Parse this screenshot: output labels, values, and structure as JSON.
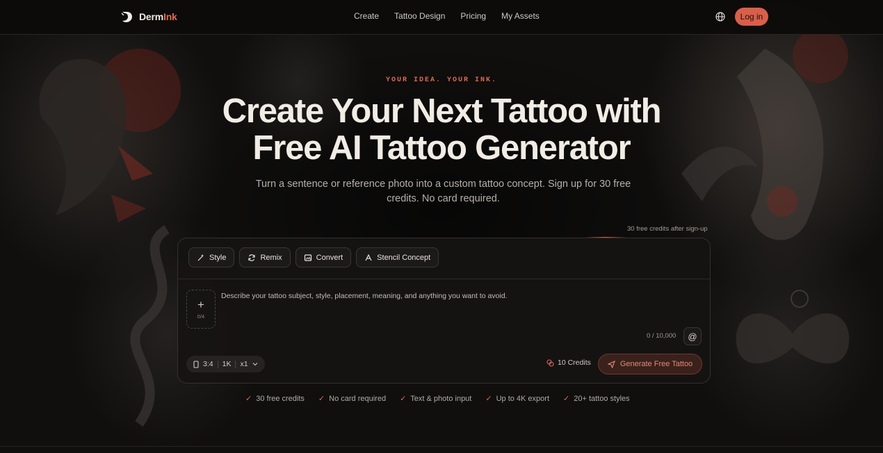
{
  "brand": {
    "name_prefix": "Derm",
    "name_suffix": "Ink",
    "accent": "#d95f4a"
  },
  "nav": {
    "links": [
      "Create",
      "Tattoo Design",
      "Pricing",
      "My Assets"
    ],
    "language_icon": "globe-icon",
    "login_label": "Log in"
  },
  "hero": {
    "eyebrow": "YOUR IDEA. YOUR INK.",
    "title_line1": "Create Your Next Tattoo with",
    "title_line2": "Free AI Tattoo Generator",
    "subtitle": "Turn a sentence or reference photo into a custom tattoo concept. Sign up for 30 free credits. No card required.",
    "free_note": "30 free credits after sign-up"
  },
  "composer": {
    "modes": [
      {
        "label": "Style",
        "icon": "magic-wand-icon"
      },
      {
        "label": "Remix",
        "icon": "refresh-icon"
      },
      {
        "label": "Convert",
        "icon": "image-convert-icon"
      },
      {
        "label": "Stencil Concept",
        "icon": "stencil-icon"
      }
    ],
    "upload_plus": "+",
    "upload_count": "0/4",
    "prompt_placeholder": "Describe your tattoo subject, style, placement, meaning, and anything you want to avoid.",
    "char_count": "0 / 10,000",
    "mention_symbol": "@",
    "aspect_ratio": "3:4",
    "resolution": "1K",
    "quantity": "x1",
    "credits": "10 Credits",
    "generate_label": "Generate Free Tattoo"
  },
  "features": [
    "30 free credits",
    "No card required",
    "Text & photo input",
    "Up to 4K export",
    "20+ tattoo styles"
  ]
}
